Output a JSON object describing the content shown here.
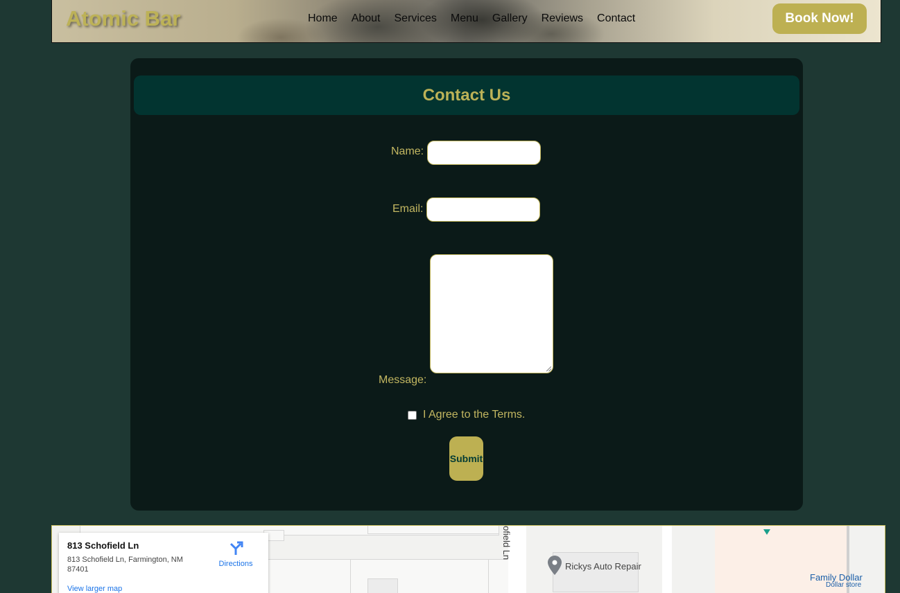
{
  "header": {
    "logo": "Atomic Bar",
    "nav": [
      "Home",
      "About",
      "Services",
      "Menu",
      "Gallery",
      "Reviews",
      "Contact"
    ],
    "cta": "Book Now!"
  },
  "contact": {
    "title": "Contact Us",
    "name_label": "Name:",
    "email_label": "Email:",
    "message_label": "Message:",
    "terms_label": "I Agree to the Terms.",
    "submit_label": "Submit"
  },
  "map": {
    "place_title": "813 Schofield Ln",
    "address": "813 Schofield Ln, Farmington, NM 87401",
    "directions_label": "Directions",
    "larger_map_link": "View larger map",
    "street_label": "ofield Ln",
    "poi_auto": "Rickys Auto Repair",
    "poi_store": "Family Dollar",
    "poi_store_type": "Dollar store"
  }
}
